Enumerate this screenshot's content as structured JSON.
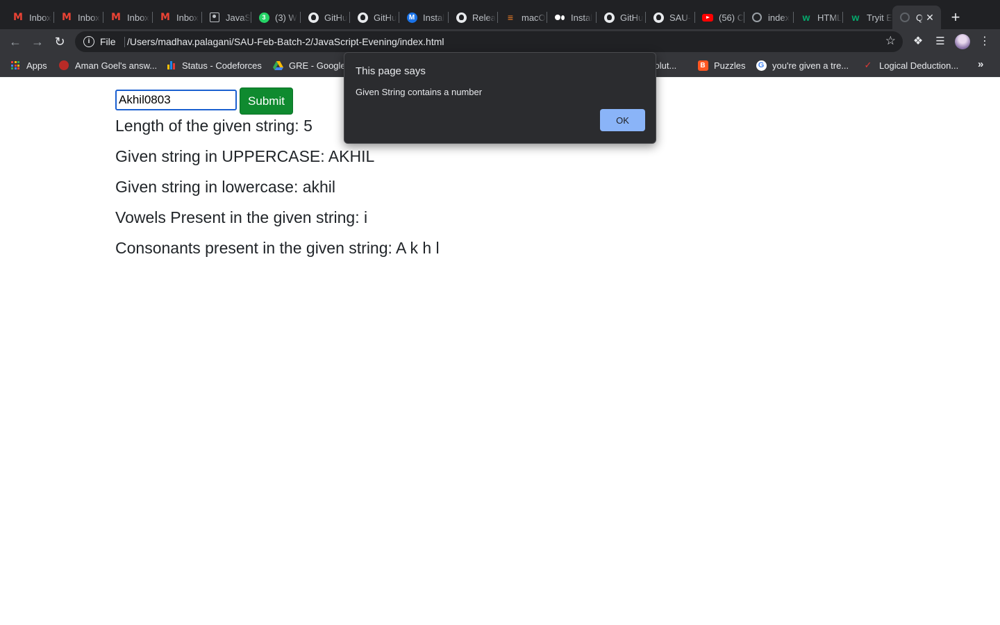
{
  "browser": {
    "tabs": [
      {
        "title": "Inbox",
        "icon": "gmail-icon"
      },
      {
        "title": "Inbox",
        "icon": "gmail-icon"
      },
      {
        "title": "Inbox",
        "icon": "gmail-icon"
      },
      {
        "title": "Inbox",
        "icon": "gmail-icon"
      },
      {
        "title": "JavaS",
        "icon": "contact-card-icon"
      },
      {
        "title": "(3) W",
        "icon": "whatsapp-icon",
        "badge": "3"
      },
      {
        "title": "GitHu",
        "icon": "github-icon"
      },
      {
        "title": "GitHu",
        "icon": "github-icon"
      },
      {
        "title": "Instal",
        "icon": "m-circle-icon",
        "badge": "M"
      },
      {
        "title": "Relea",
        "icon": "github-icon"
      },
      {
        "title": "macO",
        "icon": "stackoverflow-icon"
      },
      {
        "title": "Instal",
        "icon": "medium-icon"
      },
      {
        "title": "GitHu",
        "icon": "github-icon"
      },
      {
        "title": "SAU-",
        "icon": "github-icon"
      },
      {
        "title": "(56) C",
        "icon": "youtube-icon"
      },
      {
        "title": "index",
        "icon": "globe-icon"
      },
      {
        "title": "HTML",
        "icon": "w3schools-icon"
      },
      {
        "title": "Tryit E",
        "icon": "w3schools-icon"
      },
      {
        "title": "Q",
        "icon": "globe-icon",
        "active": true
      }
    ],
    "url_scheme": "File",
    "url": "/Users/madhav.palagani/SAU-Feb-Batch-2/JavaScript-Evening/index.html",
    "bookmarks": [
      {
        "label": "Apps",
        "icon": "apps-grid-icon"
      },
      {
        "label": "Aman Goel's answ...",
        "icon": "quora-icon"
      },
      {
        "label": "Status - Codeforces",
        "icon": "codeforces-icon"
      },
      {
        "label": "GRE - Google",
        "icon": "google-drive-icon"
      },
      {
        "label": "solut...",
        "icon": "bookmark-icon"
      },
      {
        "label": "Puzzles",
        "icon": "blogger-icon"
      },
      {
        "label": "you're given a tre...",
        "icon": "google-icon"
      },
      {
        "label": "Logical Deduction...",
        "icon": "geeksforgeeks-icon"
      }
    ],
    "colors": {
      "chrome_dark": "#202124",
      "toolbar": "#35363a",
      "dialog_button": "#8ab4f8"
    }
  },
  "page": {
    "input_value": "Akhil0803",
    "submit_label": "Submit",
    "results": [
      "Length of the given string: 5",
      "Given string in UPPERCASE: AKHIL",
      "Given string in lowercase: akhil",
      "Vowels Present in the given string: i",
      "Consonants present in the given string: A k h l"
    ],
    "colors": {
      "submit_button": "#0f8a2f",
      "input_border": "#1a5fd0"
    }
  },
  "dialog": {
    "title": "This page says",
    "message": "Given String contains a number",
    "ok_label": "OK"
  }
}
